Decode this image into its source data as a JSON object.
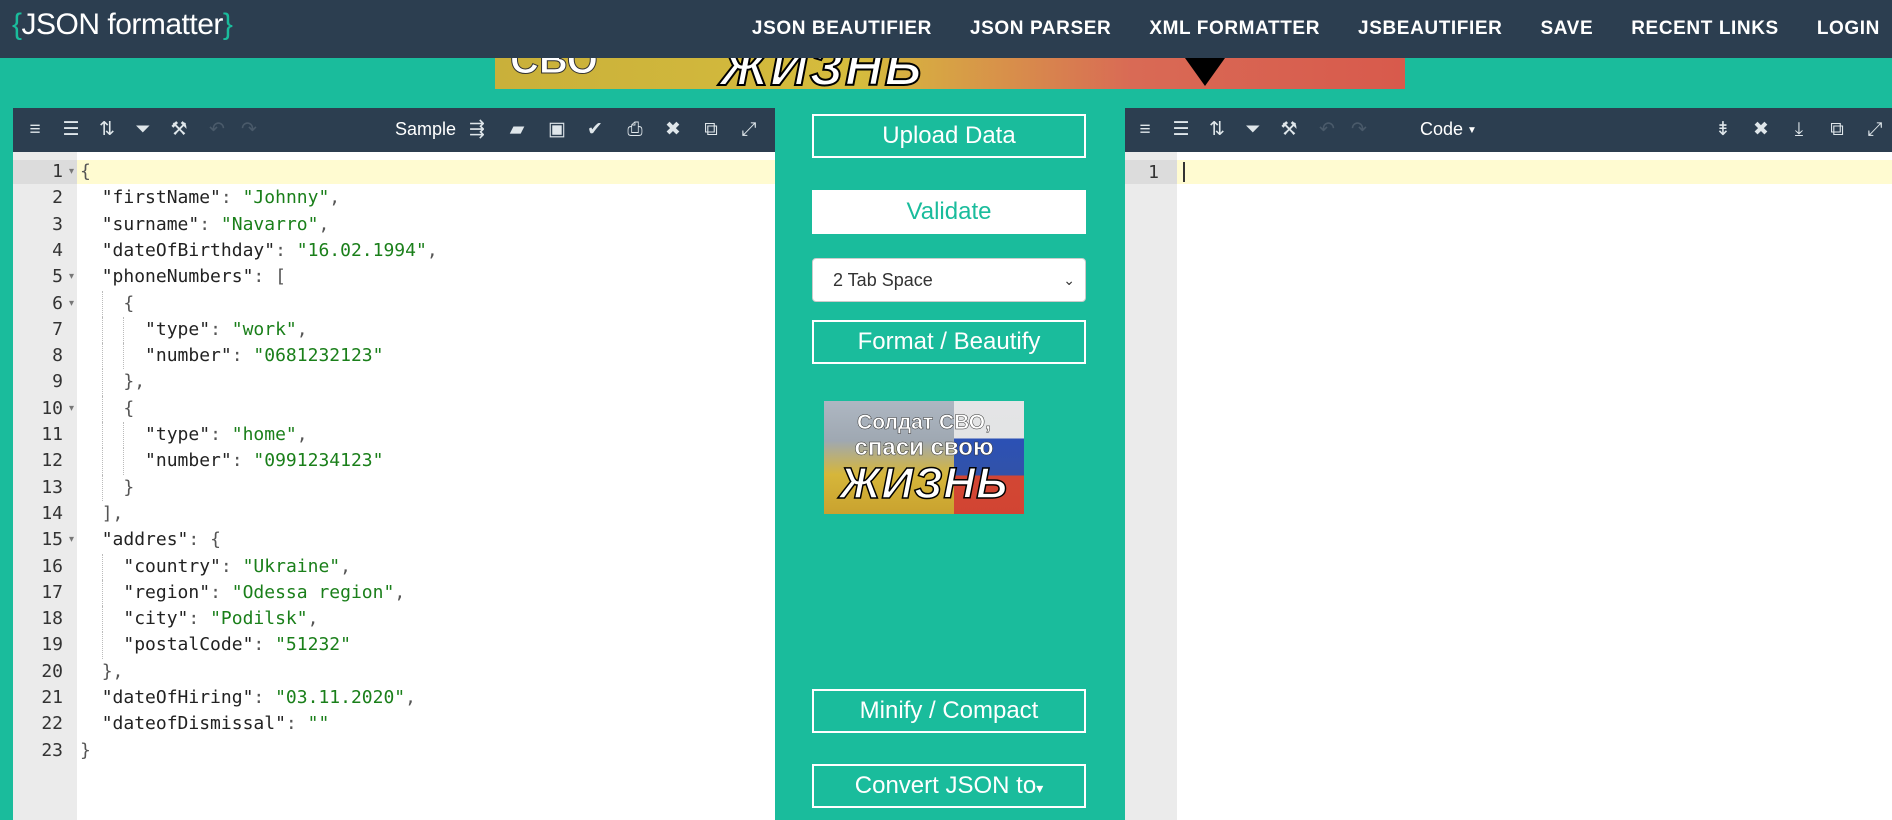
{
  "nav": {
    "logo_open": "{",
    "logo_text": "JSON formatter",
    "logo_close": "}",
    "links": [
      "JSON BEAUTIFIER",
      "JSON PARSER",
      "XML FORMATTER",
      "JSBEAUTIFIER",
      "SAVE",
      "RECENT LINKS",
      "LOGIN"
    ]
  },
  "banner": {
    "text_left": "СВО",
    "text_main": "ЖИЗНЬ"
  },
  "left_editor": {
    "sample_label": "Sample",
    "lines": [
      "{",
      "  \"firstName\": \"Johnny\",",
      "  \"surname\": \"Navarro\",",
      "  \"dateOfBirthday\": \"16.02.1994\",",
      "  \"phoneNumbers\": [",
      "    {",
      "      \"type\": \"work\",",
      "      \"number\": \"0681232123\"",
      "    },",
      "    {",
      "      \"type\": \"home\",",
      "      \"number\": \"0991234123\"",
      "    }",
      "  ],",
      "  \"addres\": {",
      "    \"country\": \"Ukraine\",",
      "    \"region\": \"Odessa region\",",
      "    \"city\": \"Podilsk\",",
      "    \"postalCode\": \"51232\"",
      "  },",
      "  \"dateOfHiring\": \"03.11.2020\",",
      "  \"dateofDismissal\": \"\"",
      "}"
    ]
  },
  "right_editor": {
    "mode_label": "Code",
    "line_numbers": [
      "1"
    ]
  },
  "controls": {
    "upload": "Upload Data",
    "validate": "Validate",
    "tab_select": "2 Tab Space",
    "format": "Format / Beautify",
    "minify": "Minify / Compact",
    "convert": "Convert JSON to",
    "convert_caret": "▾"
  },
  "ad": {
    "line1": "Солдат СВО,",
    "line2": "спаси свою",
    "line3": "ЖИЗНЬ"
  },
  "colors": {
    "accent": "#1abc9c",
    "navbar": "#2c3e50",
    "string": "#1a7f1a",
    "active_line": "#fffbd1"
  }
}
